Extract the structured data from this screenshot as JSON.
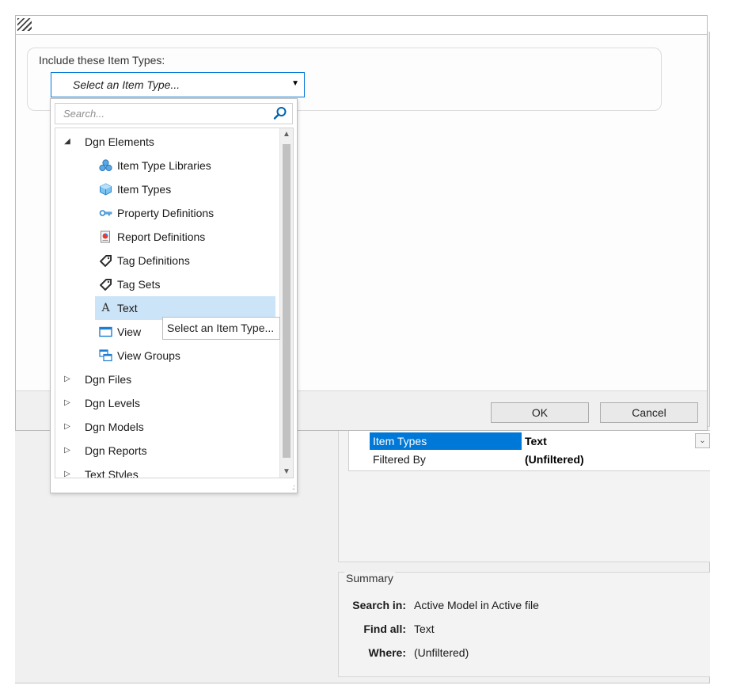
{
  "dialog": {
    "group_label": "Include these Item Types:",
    "combo_value": "Select an Item Type...",
    "ok_label": "OK",
    "cancel_label": "Cancel"
  },
  "popup": {
    "search_placeholder": "Search...",
    "tree": [
      {
        "label": "Dgn Elements",
        "expanded": true,
        "children": [
          {
            "label": "Item Type Libraries",
            "icon": "item-type-libraries-icon"
          },
          {
            "label": "Item Types",
            "icon": "item-types-icon"
          },
          {
            "label": "Property Definitions",
            "icon": "property-definitions-icon"
          },
          {
            "label": "Report Definitions",
            "icon": "report-definitions-icon"
          },
          {
            "label": "Tag Definitions",
            "icon": "tag-definitions-icon"
          },
          {
            "label": "Tag Sets",
            "icon": "tag-sets-icon"
          },
          {
            "label": "Text",
            "icon": "text-icon",
            "selected": true
          },
          {
            "label": "View",
            "icon": "view-icon"
          },
          {
            "label": "View Groups",
            "icon": "view-groups-icon"
          }
        ]
      },
      {
        "label": "Dgn Files",
        "expanded": false
      },
      {
        "label": "Dgn Levels",
        "expanded": false
      },
      {
        "label": "Dgn Models",
        "expanded": false
      },
      {
        "label": "Dgn Reports",
        "expanded": false
      },
      {
        "label": "Text Styles",
        "expanded": false
      }
    ],
    "tooltip": "Select an Item Type..."
  },
  "properties": {
    "rows": [
      {
        "key": "Item Types",
        "value": "Text",
        "selected": true
      },
      {
        "key": "Filtered By",
        "value": "(Unfiltered)",
        "selected": false
      }
    ]
  },
  "summary": {
    "title": "Summary",
    "search_in_label": "Search in:",
    "search_in_value": "Active Model  in Active file",
    "find_all_label": "Find all:",
    "find_all_value": "Text",
    "where_label": "Where:",
    "where_value": "(Unfiltered)"
  },
  "colors": {
    "accent": "#0078d7",
    "selection_bg": "#cce4f7"
  }
}
